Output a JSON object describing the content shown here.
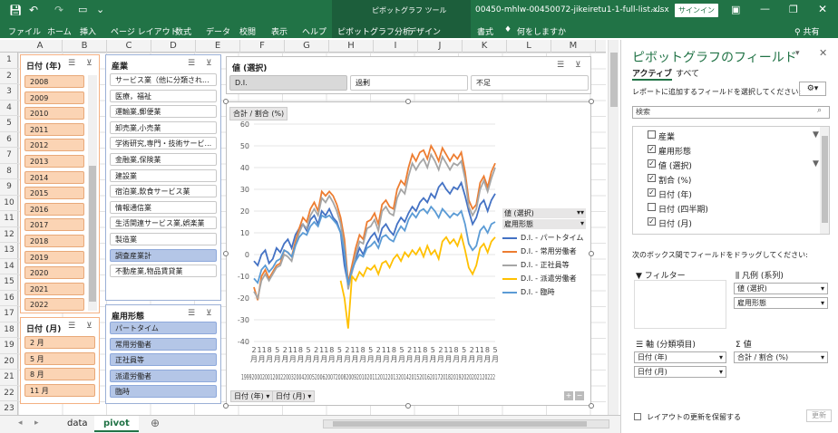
{
  "window": {
    "filename": "00450-mhlw-00450072-jikeiretu1-1-full-list.xlsx",
    "suffix": "-...",
    "ctx_tool": "ピボットグラフ ツール",
    "signin": "サインイン",
    "share": "共有"
  },
  "ribbon": {
    "tabs": [
      "ファイル",
      "ホーム",
      "挿入",
      "ページ レイアウト",
      "数式",
      "データ",
      "校閲",
      "表示",
      "ヘルプ",
      "ピボットグラフ分析",
      "デザイン",
      "書式"
    ],
    "tell_me": "何をしますか"
  },
  "columns": [
    "A",
    "B",
    "C",
    "D",
    "E",
    "F",
    "G",
    "H",
    "I",
    "J",
    "K",
    "L",
    "M"
  ],
  "rows": [
    "1",
    "2",
    "3",
    "4",
    "5",
    "6",
    "7",
    "8",
    "9",
    "10",
    "11",
    "12",
    "13",
    "14",
    "15",
    "16",
    "17",
    "18",
    "19",
    "20",
    "21",
    "22",
    "23"
  ],
  "slicer_year": {
    "title": "日付 (年)",
    "items": [
      "2008",
      "2009",
      "2010",
      "2011",
      "2012",
      "2013",
      "2014",
      "2015",
      "2016",
      "2017",
      "2018",
      "2019",
      "2020",
      "2021",
      "2022"
    ]
  },
  "slicer_month": {
    "title": "日付 (月)",
    "items": [
      "2 月",
      "5 月",
      "8 月",
      "11 月"
    ]
  },
  "slicer_industry": {
    "title": "産業",
    "items": [
      "サービス業（他に分類され...",
      "医療，福祉",
      "運輸業,郵便業",
      "卸売業,小売業",
      "学術研究,専門・技術サービ...",
      "金融業,保険業",
      "建設業",
      "宿泊業,飲食サービス業",
      "情報通信業",
      "生活関連サービス業,娯楽業",
      "製造業",
      "調査産業計",
      "不動産業,物品賃貸業"
    ],
    "selected": 11
  },
  "slicer_employment": {
    "title": "雇用形態",
    "items": [
      "パートタイム",
      "常用労働者",
      "正社員等",
      "派遣労働者",
      "臨時"
    ]
  },
  "slicer_value": {
    "title": "値 (選択)",
    "items": [
      "D.I.",
      "過剰",
      "不足"
    ]
  },
  "chart": {
    "value_field": "合計 / 割合 (%)",
    "legend_field1": "値 (選択)",
    "legend_field2": "雇用形態",
    "axis_btn1": "日付 (年)",
    "axis_btn2": "日付 (月)"
  },
  "chart_data": {
    "type": "line",
    "ylim": [
      -40,
      60
    ],
    "yticks": [
      60,
      50,
      40,
      30,
      20,
      10,
      0,
      -10,
      -20,
      -30,
      -40
    ],
    "month_labels": [
      "2",
      "11",
      "8",
      "5",
      "2",
      "11",
      "8",
      "5",
      "2",
      "11",
      "8",
      "5",
      "2",
      "11",
      "8",
      "5",
      "2",
      "11",
      "8",
      "5",
      "2",
      "11",
      "8",
      "5",
      "2",
      "11",
      "8",
      "5",
      "2",
      "11",
      "8",
      "5"
    ],
    "month_suffix": "月",
    "year_label_text": "1999200020012002200320042005200620072008200920102011201220132014201520162017201820192020202120222",
    "year_label_start": "1999",
    "year_label_end": "2022",
    "series": [
      {
        "name": "D.I. - パートタイム",
        "color": "#4472c4",
        "values": [
          -3,
          -5,
          0,
          2,
          -4,
          -2,
          3,
          1,
          5,
          7,
          3,
          9,
          12,
          14,
          11,
          16,
          18,
          14,
          20,
          18,
          21,
          17,
          15,
          10,
          -5,
          -14,
          -8,
          -2,
          3,
          0,
          5,
          8,
          10,
          6,
          12,
          14,
          11,
          9,
          14,
          17,
          15,
          19,
          22,
          20,
          24,
          26,
          24,
          28,
          26,
          31,
          33,
          30,
          28,
          31,
          30,
          33,
          27,
          20,
          14,
          17,
          23,
          25,
          20,
          25,
          28
        ]
      },
      {
        "name": "D.I. - 常用労働者",
        "color": "#ed7d31",
        "values": [
          -15,
          -21,
          -10,
          -7,
          -11,
          -8,
          -5,
          -4,
          2,
          1,
          -1,
          6,
          12,
          17,
          15,
          21,
          24,
          20,
          29,
          27,
          29,
          27,
          23,
          17,
          7,
          -13,
          -5,
          3,
          9,
          7,
          15,
          16,
          19,
          14,
          23,
          25,
          22,
          21,
          30,
          34,
          32,
          40,
          46,
          43,
          47,
          48,
          44,
          50,
          47,
          43,
          49,
          46,
          43,
          46,
          44,
          47,
          38,
          25,
          21,
          23,
          33,
          36,
          31,
          38,
          42
        ]
      },
      {
        "name": "D.I. - 正社員等",
        "color": "#a5a5a5",
        "values": [
          -17,
          -20,
          -12,
          -9,
          -12,
          -9,
          -6,
          -5,
          0,
          -1,
          -3,
          4,
          10,
          14,
          12,
          18,
          21,
          18,
          26,
          24,
          27,
          24,
          20,
          14,
          3,
          -16,
          -8,
          0,
          6,
          5,
          12,
          13,
          16,
          11,
          20,
          22,
          19,
          18,
          26,
          30,
          28,
          36,
          42,
          39,
          42,
          44,
          40,
          46,
          43,
          39,
          45,
          42,
          39,
          42,
          41,
          43,
          35,
          22,
          18,
          21,
          30,
          34,
          29,
          35,
          40
        ]
      },
      {
        "name": "D.I. - 派遣労働者",
        "color": "#ffc000",
        "values": [
          null,
          null,
          null,
          null,
          null,
          null,
          null,
          null,
          null,
          null,
          null,
          null,
          null,
          null,
          null,
          null,
          null,
          null,
          null,
          null,
          null,
          null,
          null,
          -12,
          -20,
          -34,
          -10,
          -12,
          -8,
          -10,
          -6,
          -7,
          -5,
          -9,
          -4,
          -3,
          -6,
          -2,
          0,
          -3,
          1,
          -1,
          2,
          0,
          3,
          -1,
          4,
          0,
          2,
          -2,
          6,
          8,
          5,
          7,
          4,
          9,
          2,
          -6,
          -9,
          -5,
          3,
          5,
          1,
          6,
          8
        ]
      },
      {
        "name": "D.I. - 臨時",
        "color": "#5b9bd5",
        "values": [
          -11,
          -13,
          -7,
          -5,
          -8,
          -6,
          -3,
          -2,
          2,
          1,
          -1,
          4,
          8,
          10,
          9,
          13,
          15,
          13,
          18,
          17,
          18,
          16,
          14,
          10,
          1,
          -14,
          -7,
          -3,
          0,
          -1,
          3,
          4,
          6,
          3,
          8,
          9,
          7,
          6,
          10,
          13,
          11,
          16,
          19,
          17,
          20,
          21,
          19,
          22,
          20,
          17,
          21,
          19,
          17,
          19,
          18,
          20,
          14,
          5,
          2,
          4,
          11,
          13,
          10,
          14,
          15
        ]
      }
    ]
  },
  "pane": {
    "title": "ピボットグラフのフィールド",
    "tab_active": "アクティブ",
    "tab_all": "すべて",
    "prompt": "レポートに追加するフィールドを選択してください:",
    "search": "検索",
    "fields": [
      {
        "label": "産業",
        "checked": false,
        "filter": true
      },
      {
        "label": "雇用形態",
        "checked": true,
        "filter": false
      },
      {
        "label": "値 (選択)",
        "checked": true,
        "filter": true
      },
      {
        "label": "割合 (%)",
        "checked": true,
        "filter": false
      },
      {
        "label": "日付 (年)",
        "checked": true,
        "filter": false
      },
      {
        "label": "日付 (四半期)",
        "checked": false,
        "filter": false
      },
      {
        "label": "日付 (月)",
        "checked": true,
        "filter": false
      }
    ],
    "drag_hint": "次のボックス間でフィールドをドラッグしてください:",
    "filter_label": "フィルター",
    "legend_label": "凡例 (系列)",
    "axis_label": "軸 (分類項目)",
    "values_label": "値",
    "legend_items": [
      "値 (選択)",
      "雇用形態"
    ],
    "axis_items": [
      "日付 (年)",
      "日付 (月)"
    ],
    "values_items": [
      "合計 / 割合 (%)"
    ],
    "defer": "レイアウトの更新を保留する",
    "update": "更新"
  },
  "sheets": [
    "data",
    "pivot"
  ],
  "check_mark": "✓"
}
